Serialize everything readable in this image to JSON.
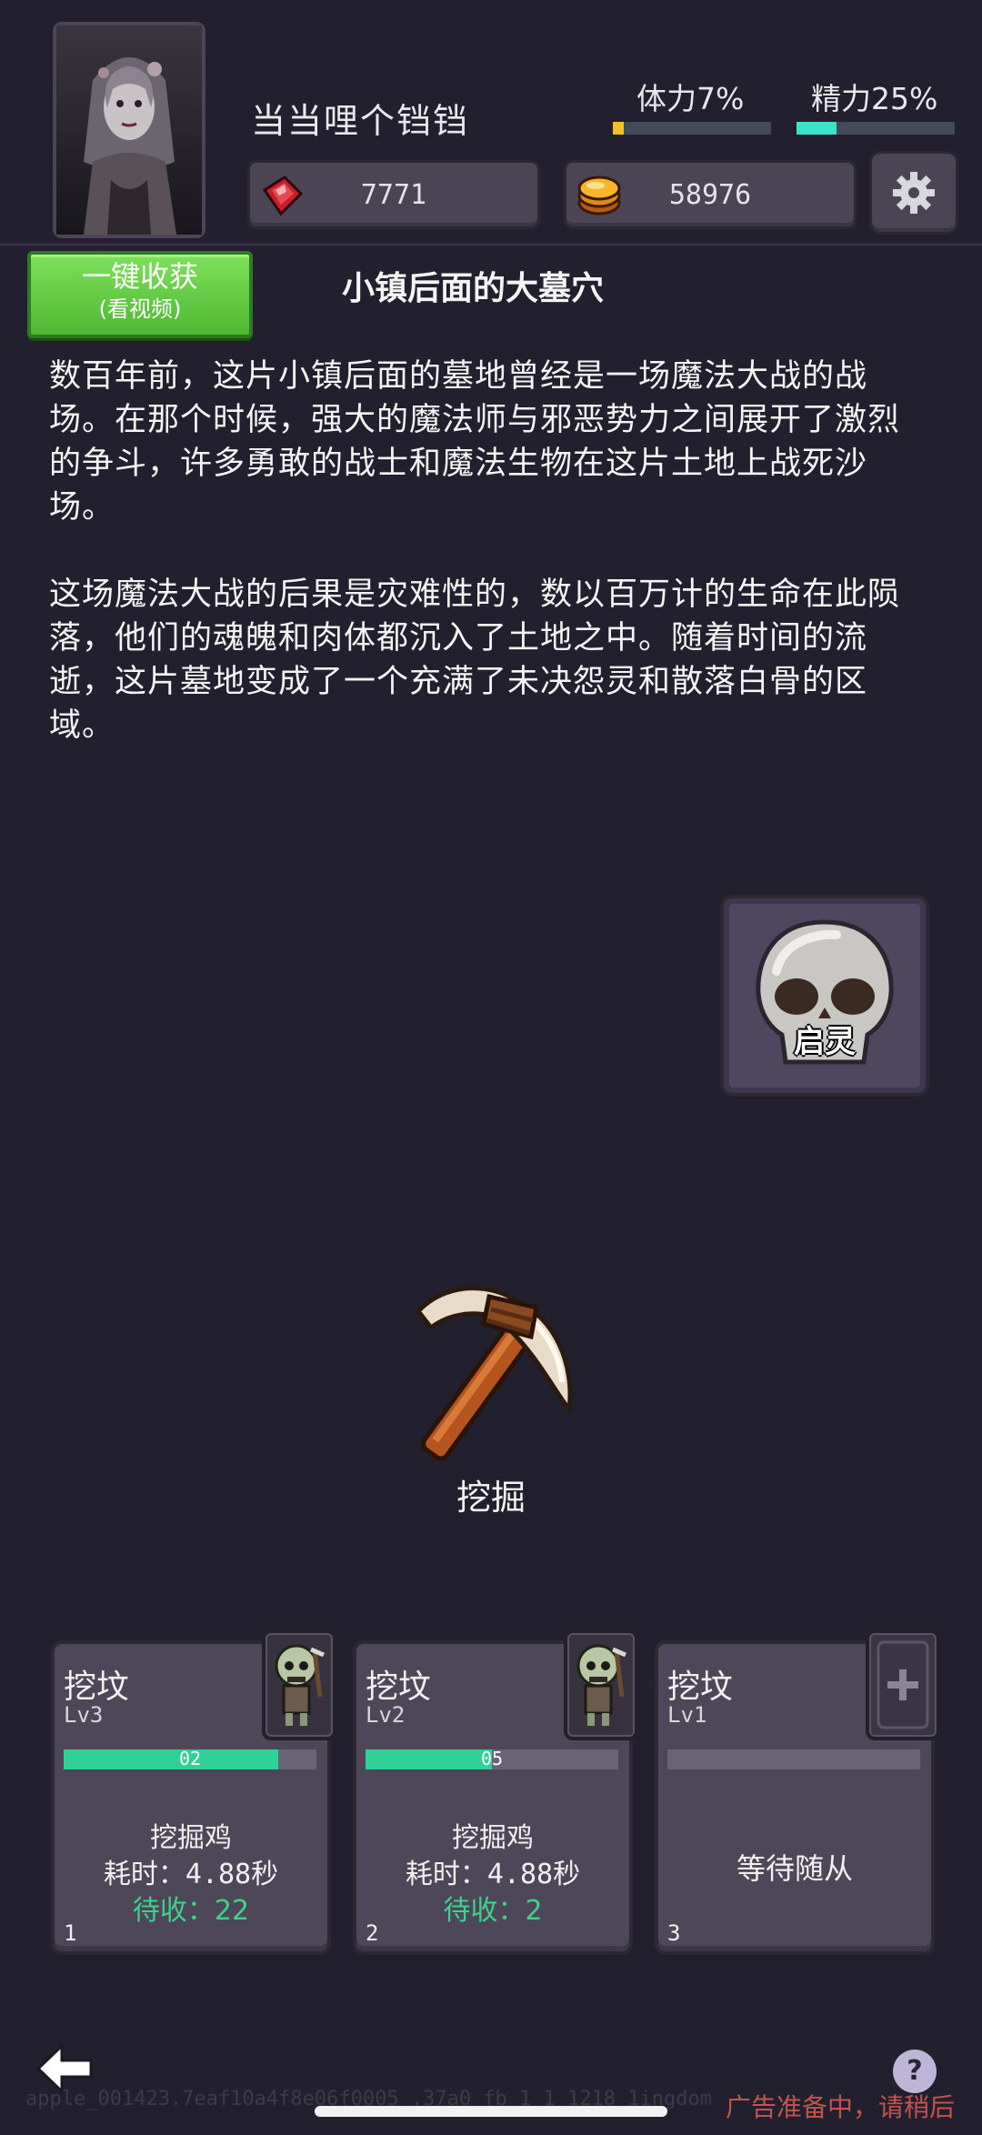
{
  "player": {
    "name": "当当哩个铛铛",
    "stamina": {
      "label": "体力",
      "percent_text": "7%",
      "value": 0.07,
      "color": "#f2c02a"
    },
    "energy": {
      "label": "精力",
      "percent_text": "25%",
      "value": 0.25,
      "color": "#3ee0c8"
    }
  },
  "resources": {
    "gems": {
      "icon": "red-crystal-icon",
      "value": "7771"
    },
    "coins": {
      "icon": "gold-coin-icon",
      "value": "58976"
    }
  },
  "harvest_button": {
    "line1": "一键收获",
    "line2": "(看视频)"
  },
  "location": {
    "title": "小镇后面的大墓穴",
    "paragraph1": "数百年前，这片小镇后面的墓地曾经是一场魔法大战的战场。在那个时候，强大的魔法师与邪恶势力之间展开了激烈的争斗，许多勇敢的战士和魔法生物在这片土地上战死沙场。",
    "paragraph2": "这场魔法大战的后果是灾难性的，数以百万计的生命在此陨落，他们的魂魄和肉体都沉入了土地之中。随着时间的流逝，这片墓地变成了一个充满了未决怨灵和散落白骨的区域。"
  },
  "spirit_button": {
    "label": "启灵",
    "icon": "skull-icon"
  },
  "dig_action": {
    "label": "挖掘",
    "icon": "pickaxe-icon"
  },
  "cards": [
    {
      "title": "挖坟",
      "level": "Lv3",
      "progress_text": "02",
      "progress": 0.85,
      "task": "挖掘鸡",
      "time_label": "耗时：",
      "time_value": "4.88秒",
      "pending_label": "待收：",
      "pending_value": "22",
      "slot": "1",
      "has_worker": true
    },
    {
      "title": "挖坟",
      "level": "Lv2",
      "progress_text": "05",
      "progress": 0.5,
      "task": "挖掘鸡",
      "time_label": "耗时：",
      "time_value": "4.88秒",
      "pending_label": "待收：",
      "pending_value": "2",
      "slot": "2",
      "has_worker": true
    },
    {
      "title": "挖坟",
      "level": "Lv1",
      "progress_text": "",
      "progress": 0,
      "waiting": "等待随从",
      "slot": "3",
      "has_worker": false
    }
  ],
  "footer": {
    "help": "?",
    "ad_status": "广告准备中，请稍后",
    "watermark": "apple_001423.7eaf10a4f8e06f0005 .37a0 fb 1 1 1218 1ingdom"
  }
}
